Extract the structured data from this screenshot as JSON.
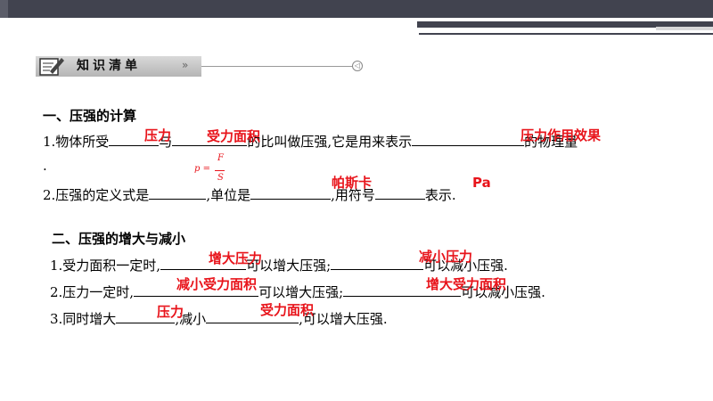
{
  "banner": {
    "title": "知识清单",
    "arrow": "»",
    "end_mark": "◁"
  },
  "section1": {
    "heading": "一、压强的计算",
    "l1_a": "1.物体所受",
    "l1_b": "与",
    "l1_c": "的比叫做压强,它是用来表示",
    "l1_d": "的物理量",
    "l1_dot": ".",
    "l2_a": "2.压强的定义式是",
    "l2_b": ",单位是",
    "l2_c": ",用符号",
    "l2_d": "表示."
  },
  "section2": {
    "heading": "二、压强的增大与减小",
    "l1_a": "1.受力面积一定时,",
    "l1_b": "可以增大压强;",
    "l1_c": "可以减小压强.",
    "l2_a": "2.压力一定时,",
    "l2_b": "可以增大压强;",
    "l2_c": "可以减小压强.",
    "l3_a": "3.同时增大",
    "l3_b": ",减小",
    "l3_c": ",可以增大压强."
  },
  "answers": {
    "a1": "压力",
    "a2": "受力面积",
    "a3": "压力作用效果",
    "formula": {
      "lhs": "p =",
      "num": "F",
      "den": "S"
    },
    "a4": "帕斯卡",
    "a5": "Pa",
    "a6": "增大压力",
    "a7": "减小压力",
    "a8": "减小受力面积",
    "a9": "增大受力面积",
    "a10": "压力",
    "a11": "受力面积"
  },
  "colors": {
    "answer": "#e8141b",
    "topbar": "#41434f"
  }
}
